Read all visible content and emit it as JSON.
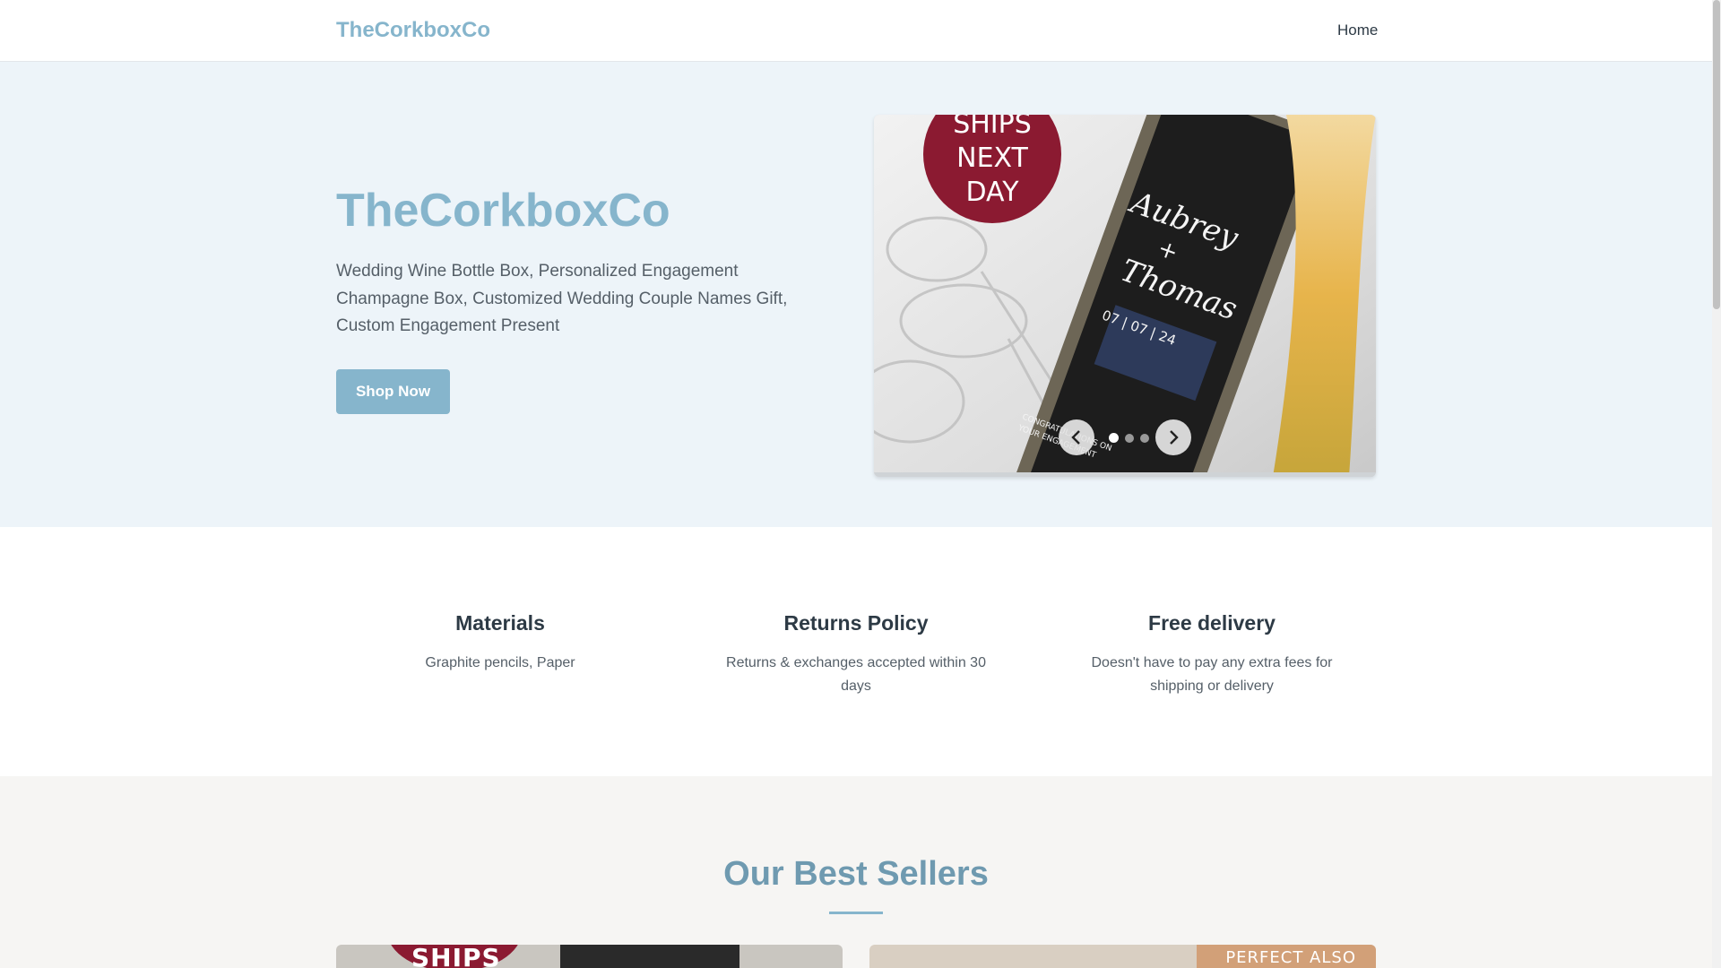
{
  "header": {
    "brand": "TheCorkboxCo",
    "nav": [
      {
        "label": "Home"
      }
    ]
  },
  "hero": {
    "title": "TheCorkboxCo",
    "description": "Wedding Wine Bottle Box, Personalized Engagement Champagne Box, Customized Wedding Couple Names Gift, Custom Engagement Present",
    "cta_label": "Shop Now",
    "carousel": {
      "slide_count": 3,
      "active_index": 0,
      "prev_icon": "chevron-left-icon",
      "next_icon": "chevron-right-icon",
      "slide_text": {
        "badge_line1": "SHIPS",
        "badge_line2": "NEXT",
        "badge_line3": "DAY",
        "name1": "Aubrey",
        "plus": "+",
        "name2": "Thomas",
        "date": "07 | 07 | 24",
        "engraving_line1": "CONGRATULATIONS ON",
        "engraving_line2": "YOUR ENGAGEMENT"
      }
    }
  },
  "features": [
    {
      "title": "Materials",
      "text": "Graphite pencils, Paper"
    },
    {
      "title": "Returns Policy",
      "text": "Returns & exchanges accepted within 30 days"
    },
    {
      "title": "Free delivery",
      "text": "Doesn't have to pay any extra fees for shipping or delivery"
    }
  ],
  "bestsellers": {
    "title": "Our Best Sellers",
    "cards": [
      {
        "badge_text": "SHIPS"
      },
      {
        "banner_text": "PERFECT ALSO"
      }
    ]
  },
  "colors": {
    "brand": "#86b5cc",
    "hero_bg": "#edf4f9",
    "section_bg": "#f6f5f3",
    "badge_red": "#8b1a31"
  }
}
